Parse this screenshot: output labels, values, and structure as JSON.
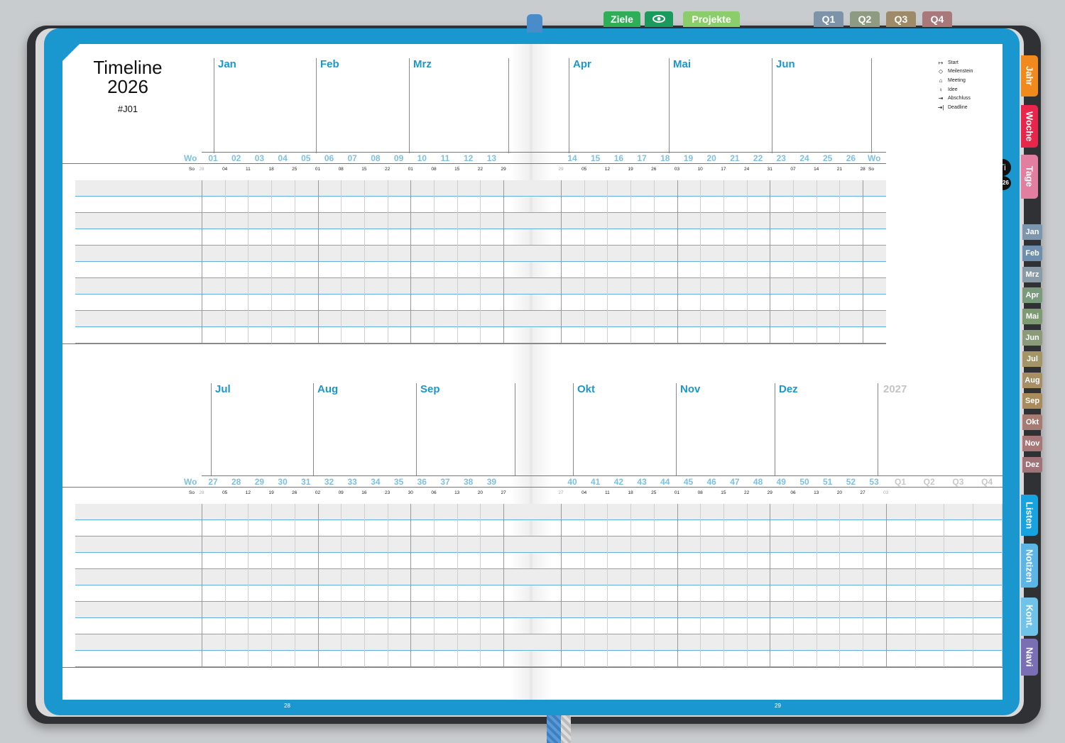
{
  "header": {
    "title_line1": "Timeline",
    "title_line2": "2026",
    "code": "#J01"
  },
  "top_tabs": [
    {
      "label": "Ziele",
      "color": "#2fae58"
    },
    {
      "label": "eye",
      "icon": "eye-icon",
      "color": "#1b9a5e"
    },
    {
      "label": "Projekte",
      "color": "#8ccd6b"
    },
    {
      "label": "Q1",
      "color": "#7d93a8"
    },
    {
      "label": "Q2",
      "color": "#8e9a82"
    },
    {
      "label": "Q3",
      "color": "#9e8a68"
    },
    {
      "label": "Q4",
      "color": "#a8787b"
    }
  ],
  "side_tabs": [
    {
      "label": "Jahr",
      "color": "#f08a1c"
    },
    {
      "label": "Woche",
      "color": "#e8254b"
    },
    {
      "label": "Tage",
      "color": "#e27ea0"
    },
    {
      "label": "Listen",
      "color": "#17a3e0"
    },
    {
      "label": "Notizen",
      "color": "#5bb6e6"
    },
    {
      "label": "Kont.",
      "color": "#6fc3e8"
    },
    {
      "label": "Navi",
      "color": "#7a6fb5"
    }
  ],
  "month_tabs": [
    {
      "label": "Jan",
      "color": "#7b96ad"
    },
    {
      "label": "Feb",
      "color": "#6d8fad"
    },
    {
      "label": "Mrz",
      "color": "#8a9ba8"
    },
    {
      "label": "Apr",
      "color": "#7a9a7c"
    },
    {
      "label": "Mai",
      "color": "#7d9a72"
    },
    {
      "label": "Jun",
      "color": "#8b9a78"
    },
    {
      "label": "Jul",
      "color": "#a39566"
    },
    {
      "label": "Aug",
      "color": "#a88f63"
    },
    {
      "label": "Sep",
      "color": "#a98b5c"
    },
    {
      "label": "Okt",
      "color": "#a67c72"
    },
    {
      "label": "Nov",
      "color": "#a87878"
    },
    {
      "label": "Dez",
      "color": "#9f7378"
    }
  ],
  "badges": {
    "ti": "Ti",
    "year": "2026"
  },
  "legend": [
    {
      "icon": "↦",
      "icon_name": "start-icon",
      "label": "Start"
    },
    {
      "icon": "◇",
      "icon_name": "milestone-icon",
      "label": "Meilenstein"
    },
    {
      "icon": "⌂",
      "icon_name": "meeting-icon",
      "label": "Meeting"
    },
    {
      "icon": "♀",
      "icon_name": "idea-icon",
      "label": "Idee"
    },
    {
      "icon": "⇥",
      "icon_name": "finish-icon",
      "label": "Abschluss"
    },
    {
      "icon": "⇥|",
      "icon_name": "deadline-icon",
      "label": "Deadline"
    }
  ],
  "wo_label": "Wo",
  "so_label": "So",
  "half1": {
    "months": [
      "Jan",
      "Feb",
      "Mrz",
      "Apr",
      "Mai",
      "Jun"
    ],
    "weeks_left": [
      "01",
      "02",
      "03",
      "04",
      "05",
      "06",
      "07",
      "08",
      "09",
      "10",
      "11",
      "12",
      "13"
    ],
    "weeks_right": [
      "14",
      "15",
      "16",
      "17",
      "18",
      "19",
      "20",
      "21",
      "22",
      "23",
      "24",
      "25",
      "26"
    ],
    "dates_left": [
      "28",
      "04",
      "11",
      "18",
      "25",
      "01",
      "08",
      "15",
      "22",
      "01",
      "08",
      "15",
      "22",
      "29"
    ],
    "dates_right": [
      "29",
      "05",
      "12",
      "19",
      "26",
      "03",
      "10",
      "17",
      "24",
      "31",
      "07",
      "14",
      "21",
      "28"
    ]
  },
  "half2": {
    "months": [
      "Jul",
      "Aug",
      "Sep",
      "Okt",
      "Nov",
      "Dez"
    ],
    "next_year": "2027",
    "weeks_left": [
      "27",
      "28",
      "29",
      "30",
      "31",
      "32",
      "33",
      "34",
      "35",
      "36",
      "37",
      "38",
      "39"
    ],
    "weeks_right": [
      "40",
      "41",
      "42",
      "43",
      "44",
      "45",
      "46",
      "47",
      "48",
      "49",
      "50",
      "51",
      "52",
      "53"
    ],
    "quarters_next": [
      "Q1",
      "Q2",
      "Q3",
      "Q4"
    ],
    "dates_left": [
      "28",
      "05",
      "12",
      "19",
      "26",
      "02",
      "09",
      "16",
      "23",
      "30",
      "06",
      "13",
      "20",
      "27"
    ],
    "dates_right": [
      "27",
      "04",
      "11",
      "18",
      "25",
      "01",
      "08",
      "15",
      "22",
      "29",
      "06",
      "13",
      "20",
      "27",
      "03"
    ]
  },
  "page_numbers": [
    "28",
    "29"
  ]
}
